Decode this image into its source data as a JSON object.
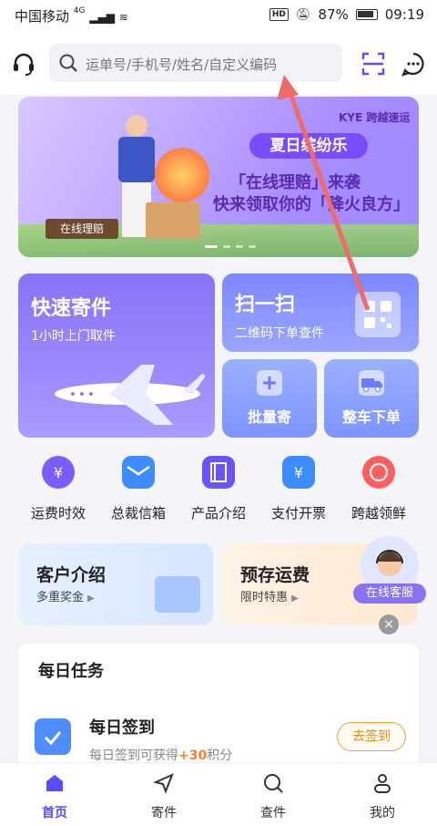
{
  "status_bar": {
    "carrier": "中国移动",
    "network": "4G",
    "battery": "87%",
    "time": "09:19"
  },
  "header": {
    "search_placeholder": "运单号/手机号/姓名/自定义编码"
  },
  "banner": {
    "logo": "KYE 跨越速运",
    "title": "夏日缤纷乐",
    "line1": "「在线理赔」来袭",
    "line2": "快来领取你的「降火良方」",
    "tag": "在线理赔"
  },
  "cards": {
    "quick": {
      "title": "快速寄件",
      "subtitle": "1小时上门取件"
    },
    "scan": {
      "title": "扫一扫",
      "subtitle": "二维码下单查件"
    },
    "bulk": {
      "label": "批量寄"
    },
    "truck": {
      "label": "整车下单"
    }
  },
  "icon_row": [
    {
      "label": "运费时效",
      "color": "#7a5cff"
    },
    {
      "label": "总裁信箱",
      "color": "#3e8cff"
    },
    {
      "label": "产品介绍",
      "color": "#6a53ff"
    },
    {
      "label": "支付开票",
      "color": "#3e8cff"
    },
    {
      "label": "跨越领鲜",
      "color": "#ff5f5f"
    }
  ],
  "promos": {
    "left": {
      "title": "客户介绍",
      "subtitle": "多重奖金"
    },
    "right": {
      "title": "预存运费",
      "subtitle": "限时特惠"
    },
    "customer_service": "在线客服"
  },
  "task": {
    "header": "每日任务",
    "title": "每日签到",
    "desc_prefix": "每日签到可获得",
    "points": "+30",
    "desc_suffix": "积分",
    "button": "去签到"
  },
  "nav": [
    {
      "label": "首页"
    },
    {
      "label": "寄件"
    },
    {
      "label": "查件"
    },
    {
      "label": "我的"
    }
  ]
}
